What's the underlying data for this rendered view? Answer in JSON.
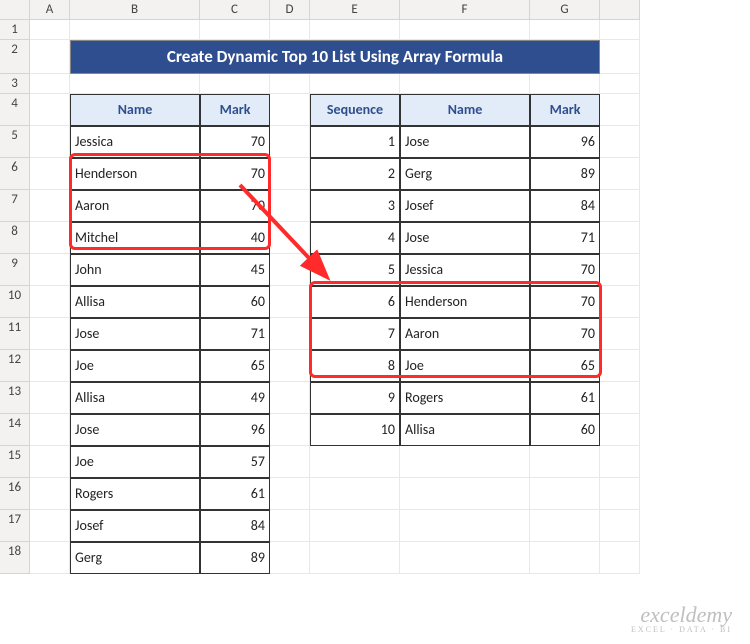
{
  "columns": [
    "A",
    "B",
    "C",
    "D",
    "E",
    "F",
    "G",
    ""
  ],
  "rows": [
    "1",
    "2",
    "3",
    "4",
    "5",
    "6",
    "7",
    "8",
    "9",
    "10",
    "11",
    "12",
    "13",
    "14",
    "15",
    "16",
    "17",
    "18"
  ],
  "title": "Create Dynamic Top 10 List Using Array Formula",
  "left_table": {
    "headers": [
      "Name",
      "Mark"
    ],
    "rows": [
      {
        "name": "Jessica",
        "mark": 70
      },
      {
        "name": "Henderson",
        "mark": 70
      },
      {
        "name": "Aaron",
        "mark": 70
      },
      {
        "name": "Mitchel",
        "mark": 40
      },
      {
        "name": "John",
        "mark": 45
      },
      {
        "name": "Allisa",
        "mark": 60
      },
      {
        "name": "Jose",
        "mark": 71
      },
      {
        "name": "Joe",
        "mark": 65
      },
      {
        "name": "Allisa",
        "mark": 49
      },
      {
        "name": "Jose",
        "mark": 96
      },
      {
        "name": "Joe",
        "mark": 57
      },
      {
        "name": "Rogers",
        "mark": 61
      },
      {
        "name": "Josef",
        "mark": 84
      },
      {
        "name": "Gerg",
        "mark": 89
      }
    ]
  },
  "right_table": {
    "headers": [
      "Sequence",
      "Name",
      "Mark"
    ],
    "rows": [
      {
        "seq": 1,
        "name": "Jose",
        "mark": 96
      },
      {
        "seq": 2,
        "name": "Gerg",
        "mark": 89
      },
      {
        "seq": 3,
        "name": "Josef",
        "mark": 84
      },
      {
        "seq": 4,
        "name": "Jose",
        "mark": 71
      },
      {
        "seq": 5,
        "name": "Jessica",
        "mark": 70
      },
      {
        "seq": 6,
        "name": "Henderson",
        "mark": 70
      },
      {
        "seq": 7,
        "name": "Aaron",
        "mark": 70
      },
      {
        "seq": 8,
        "name": "Joe",
        "mark": 65
      },
      {
        "seq": 9,
        "name": "Rogers",
        "mark": 61
      },
      {
        "seq": 10,
        "name": "Allisa",
        "mark": 60
      }
    ]
  },
  "watermark": {
    "brand": "exceldemy",
    "sub": "EXCEL · DATA · BI"
  }
}
